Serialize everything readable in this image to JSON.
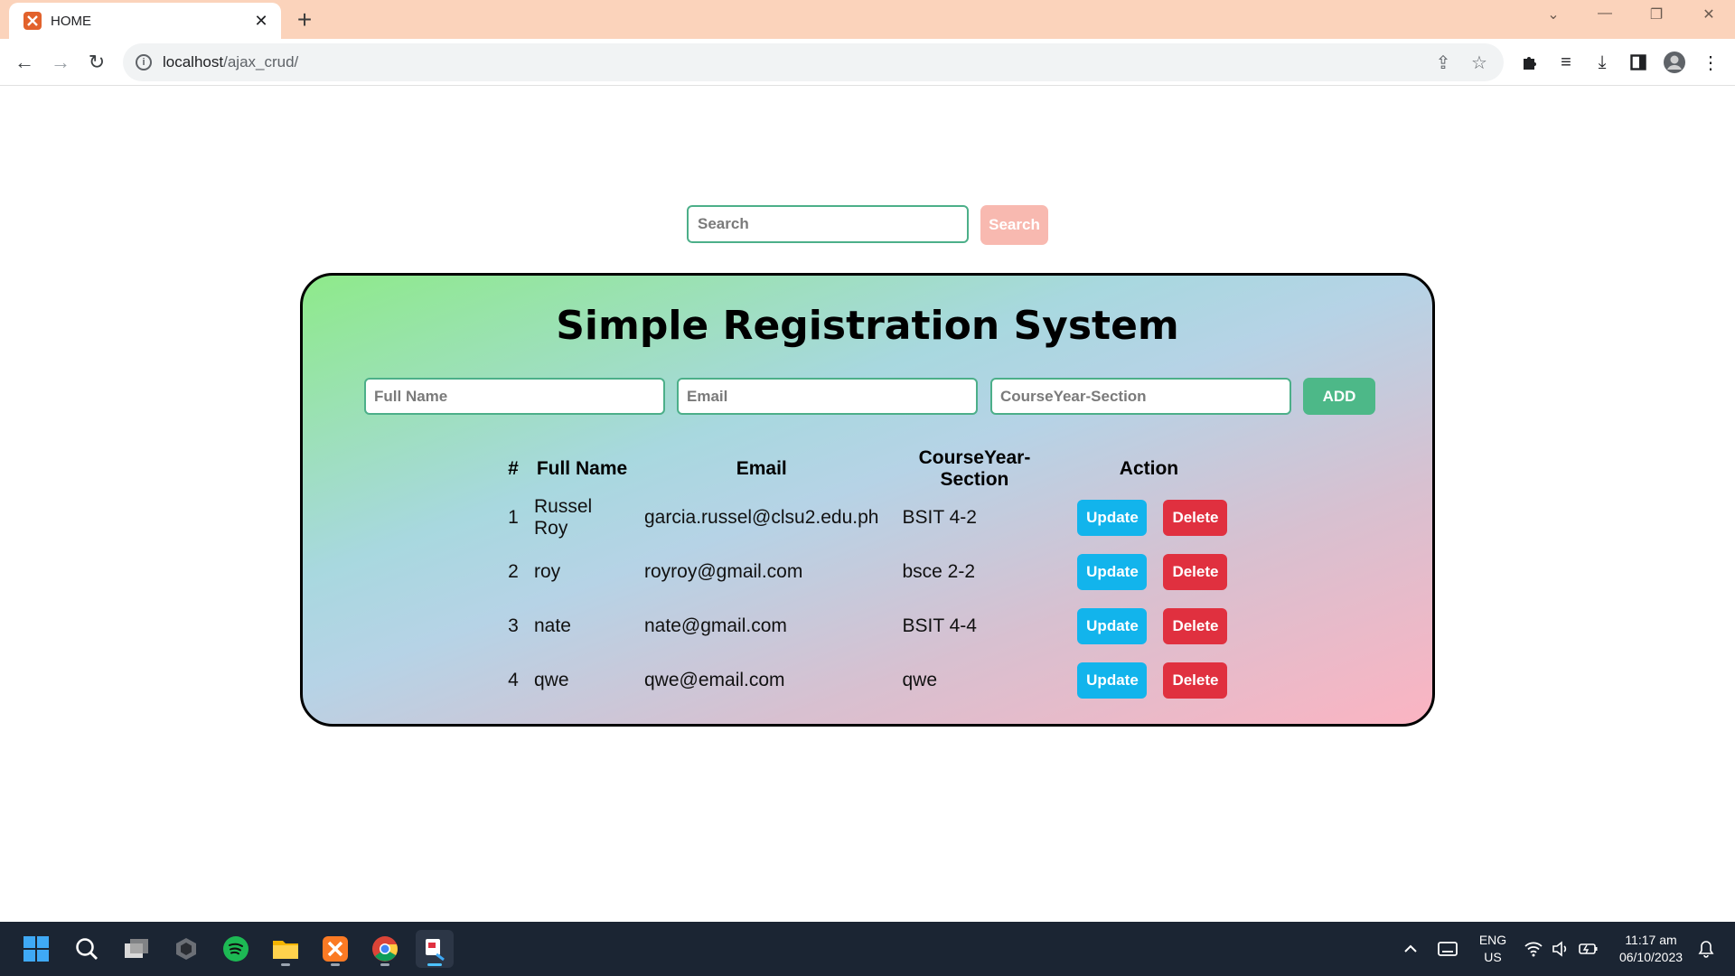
{
  "browser": {
    "tab_title": "HOME",
    "url_host": "localhost",
    "url_path": "/ajax_crud/"
  },
  "page": {
    "search": {
      "placeholder": "Search",
      "button": "Search"
    },
    "title": "Simple Registration System",
    "form": {
      "fullname_placeholder": "Full Name",
      "email_placeholder": "Email",
      "course_placeholder": "CourseYear-Section",
      "add_button": "ADD"
    },
    "table": {
      "headers": [
        "#",
        "Full Name",
        "Email",
        "CourseYear-Section",
        "Action"
      ],
      "rows": [
        {
          "id": "1",
          "name": "Russel Roy",
          "email": "garcia.russel@clsu2.edu.ph",
          "course": "BSIT 4-2"
        },
        {
          "id": "2",
          "name": "roy",
          "email": "royroy@gmail.com",
          "course": "bsce 2-2"
        },
        {
          "id": "3",
          "name": "nate",
          "email": "nate@gmail.com",
          "course": "BSIT 4-4"
        },
        {
          "id": "4",
          "name": "qwe",
          "email": "qwe@email.com",
          "course": "qwe"
        }
      ],
      "update_label": "Update",
      "delete_label": "Delete"
    }
  },
  "taskbar": {
    "language": "ENG",
    "region": "US",
    "time": "11:17 am",
    "date": "06/10/2023"
  },
  "colors": {
    "tab_strip": "#fbd3bb",
    "accent_green": "#4db888",
    "update_blue": "#12b4ec",
    "delete_red": "#e0303f",
    "search_button": "#f8b9b0"
  }
}
